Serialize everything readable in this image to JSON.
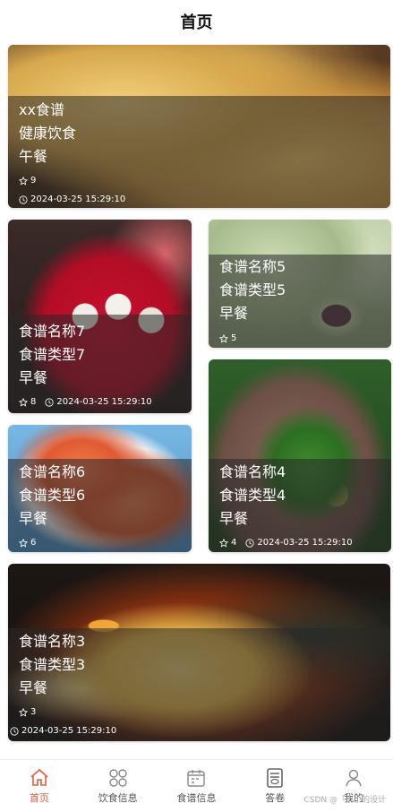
{
  "header": {
    "title": "首页"
  },
  "cards": [
    {
      "line1": "xx食谱",
      "line2": "健康饮食",
      "line3": "午餐",
      "likes": "9",
      "time": "2024-03-25 15:29:10"
    },
    {
      "line1": "食谱名称7",
      "line2": "食谱类型7",
      "line3": "早餐",
      "likes": "8",
      "time": "2024-03-25 15:29:10"
    },
    {
      "line1": "食谱名称5",
      "line2": "食谱类型5",
      "line3": "早餐",
      "likes": "5",
      "time": ""
    },
    {
      "line1": "食谱名称6",
      "line2": "食谱类型6",
      "line3": "早餐",
      "likes": "6",
      "time": ""
    },
    {
      "line1": "食谱名称4",
      "line2": "食谱类型4",
      "line3": "早餐",
      "likes": "4",
      "time": "2024-03-25 15:29:10"
    },
    {
      "line1": "食谱名称3",
      "line2": "食谱类型3",
      "line3": "早餐",
      "likes": "3",
      "time": "2024-03-25 15:29:10"
    }
  ],
  "tabbar": {
    "items": [
      {
        "label": "首页",
        "icon": "home-icon",
        "active": true
      },
      {
        "label": "饮食信息",
        "icon": "grid-icon",
        "active": false
      },
      {
        "label": "食谱信息",
        "icon": "calendar-icon",
        "active": false
      },
      {
        "label": "答卷",
        "icon": "exam-icon",
        "active": false
      },
      {
        "label": "我的",
        "icon": "user-icon",
        "active": false
      }
    ]
  },
  "watermark": "CSDN @「小小的设计",
  "colors": {
    "accent": "#e8583a"
  }
}
